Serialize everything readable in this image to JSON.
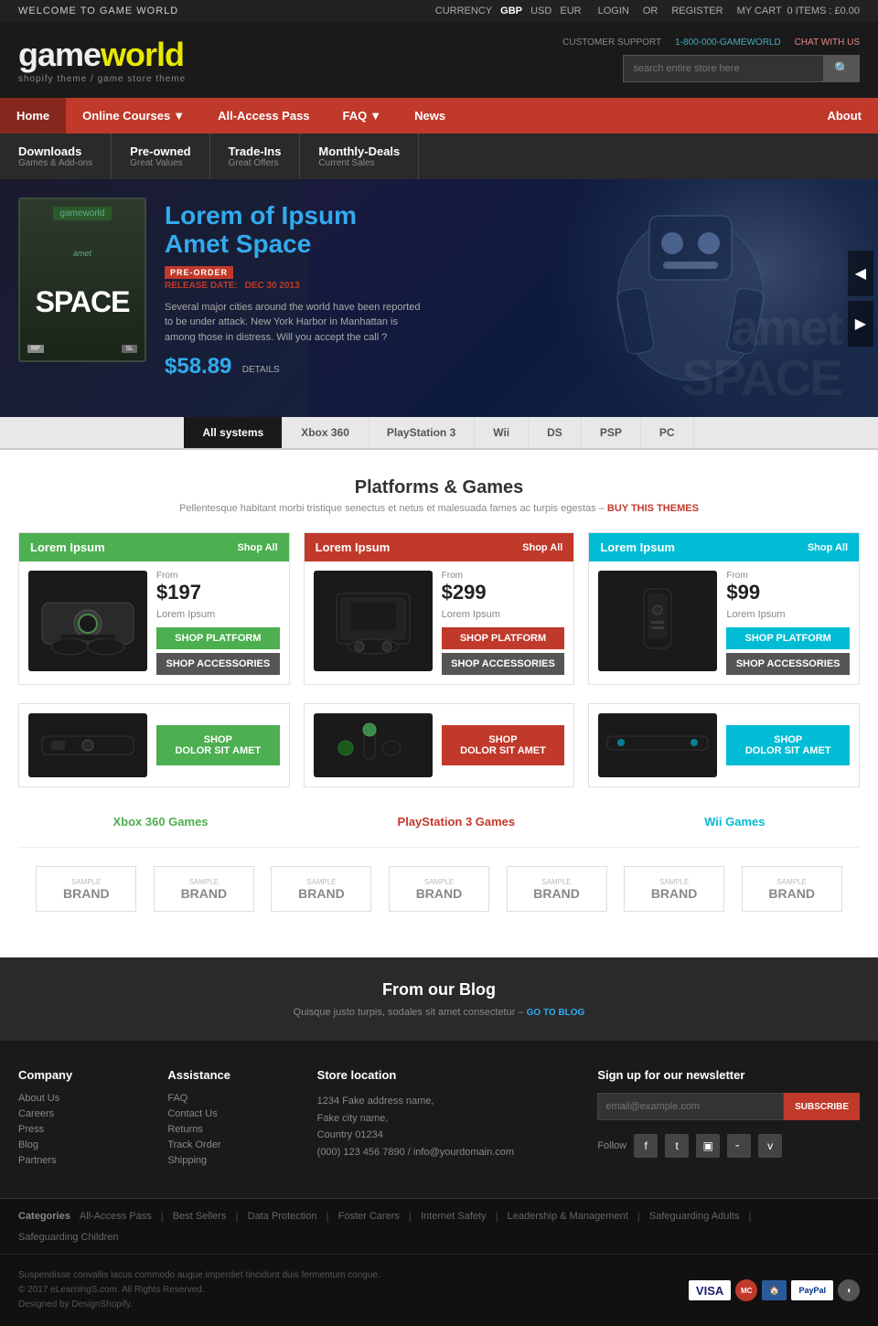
{
  "topbar": {
    "welcome": "WELCOME TO GAME WORLD",
    "currency_label": "CURRENCY",
    "currency_gbp": "GBP",
    "currency_usd": "USD",
    "currency_eur": "EUR",
    "login": "LOGIN",
    "or": "OR",
    "register": "REGISTER",
    "cart": "MY CART",
    "cart_items": "0 ITEMS",
    "cart_total": "£0.00"
  },
  "header": {
    "logo_main": "gameworld",
    "logo_sub": "shopify theme / game store theme",
    "customer_support": "CUSTOMER SUPPORT",
    "phone": "1-800-000-GAMEWORLD",
    "chat": "CHAT WITH US",
    "search_placeholder": "search entire store here"
  },
  "nav": {
    "home": "Home",
    "online_courses": "Online Courses",
    "all_access": "All-Access Pass",
    "faq": "FAQ",
    "news": "News",
    "about": "About"
  },
  "promo_tabs": [
    {
      "title": "Downloads",
      "sub": "Games & Add-ons"
    },
    {
      "title": "Pre-owned",
      "sub": "Great Values"
    },
    {
      "title": "Trade-Ins",
      "sub": "Great Offers"
    },
    {
      "title": "Monthly-Deals",
      "sub": "Current Sales"
    }
  ],
  "hero": {
    "game_logo": "gameworld",
    "game_title": "amet\nSPACE",
    "title_line1": "Lorem of Ipsum",
    "title_line2": "Amet Space",
    "preorder_label": "PRE-ORDER",
    "release_label": "RELEASE DATE:",
    "release_date": "DEC 30 2013",
    "description": "Several major cities around the world have been reported to be under attack. New York Harbor in Manhattan is among those in distress.\nWill you accept the call ?",
    "price": "$58.89",
    "details": "DETAILS",
    "watermark": "amet\nSPACE"
  },
  "systems_tabs": [
    {
      "label": "All systems",
      "active": true
    },
    {
      "label": "Xbox 360"
    },
    {
      "label": "PlayStation 3"
    },
    {
      "label": "Wii"
    },
    {
      "label": "DS"
    },
    {
      "label": "PSP"
    },
    {
      "label": "PC"
    }
  ],
  "platforms_section": {
    "title": "Platforms & Games",
    "subtitle": "Pellentesque habitant morbi tristique senectus et netus et malesuada fames ac turpis egestas",
    "buy_themes": "BUY THIS THEMES"
  },
  "platforms": [
    {
      "name": "Lorem Ipsum",
      "color": "green",
      "shop_all": "Shop All",
      "from": "From",
      "price": "$197",
      "desc": "Lorem Ipsum",
      "btn_platform": "SHOP PLATFORM",
      "btn_accessories": "SHOP ACCESSORIES",
      "games_link": "Xbox 360 Games",
      "accessory_btn": "SHOP\nDOLOR SIT AMET"
    },
    {
      "name": "Lorem Ipsum",
      "color": "red",
      "shop_all": "Shop All",
      "from": "From",
      "price": "$299",
      "desc": "Lorem Ipsum",
      "btn_platform": "SHOP PLATFORM",
      "btn_accessories": "SHOP ACCESSORIES",
      "games_link": "PlayStation 3 Games",
      "accessory_btn": "SHOP\nDOLOR SIT AMET"
    },
    {
      "name": "Lorem Ipsum",
      "color": "teal",
      "shop_all": "Shop All",
      "from": "From",
      "price": "$99",
      "desc": "Lorem Ipsum",
      "btn_platform": "SHOP PLATFORM",
      "btn_accessories": "SHOP ACCESSORIES",
      "games_link": "Wii Games",
      "accessory_btn": "SHOP\nDOLOR SIT AMET"
    }
  ],
  "brands": [
    "SAMPLE\nBRAND",
    "SAMPLE\nBRAND",
    "SAMPLE\nBRAND",
    "SAMPLE\nBRAND",
    "SAMPLE\nBRAND",
    "SAMPLE\nBRAND",
    "SAMPLE\nBRAND"
  ],
  "blog": {
    "title": "From our Blog",
    "subtitle": "Quisque justo turpis, sodales sit amet consectetur",
    "link": "GO TO BLOG"
  },
  "footer": {
    "company": {
      "heading": "Company",
      "links": [
        "About Us",
        "Careers",
        "Press",
        "Blog",
        "Partners"
      ]
    },
    "assistance": {
      "heading": "Assistance",
      "links": [
        "FAQ",
        "Contact Us",
        "Returns",
        "Track Order",
        "Shipping"
      ]
    },
    "store_location": {
      "heading": "Store location",
      "address1": "1234 Fake address name",
      "address2": "Fake city name",
      "country": "Country 01234",
      "phone": "(000) 123 456 7890",
      "email": "info@yourdomain.com"
    },
    "newsletter": {
      "heading": "Sign up for our newsletter",
      "placeholder": "email@example.com",
      "btn": "SUBSCRIBE",
      "follow": "Follow"
    }
  },
  "categories": {
    "label": "Categories",
    "links": [
      "All-Access Pass",
      "Best Sellers",
      "Data Protection",
      "Foster Carers",
      "Internet Safety",
      "Leadership & Management",
      "Safeguarding Adults",
      "Safeguarding Children"
    ]
  },
  "copyright": {
    "line1": "Suspendisse convallis lacus commodo augue imperdiet tincidunt duis fermentum congue.",
    "line2": "© 2017 eLearningS.com. All Rights Reserved.",
    "line3": "Designed by DesignShopify."
  }
}
